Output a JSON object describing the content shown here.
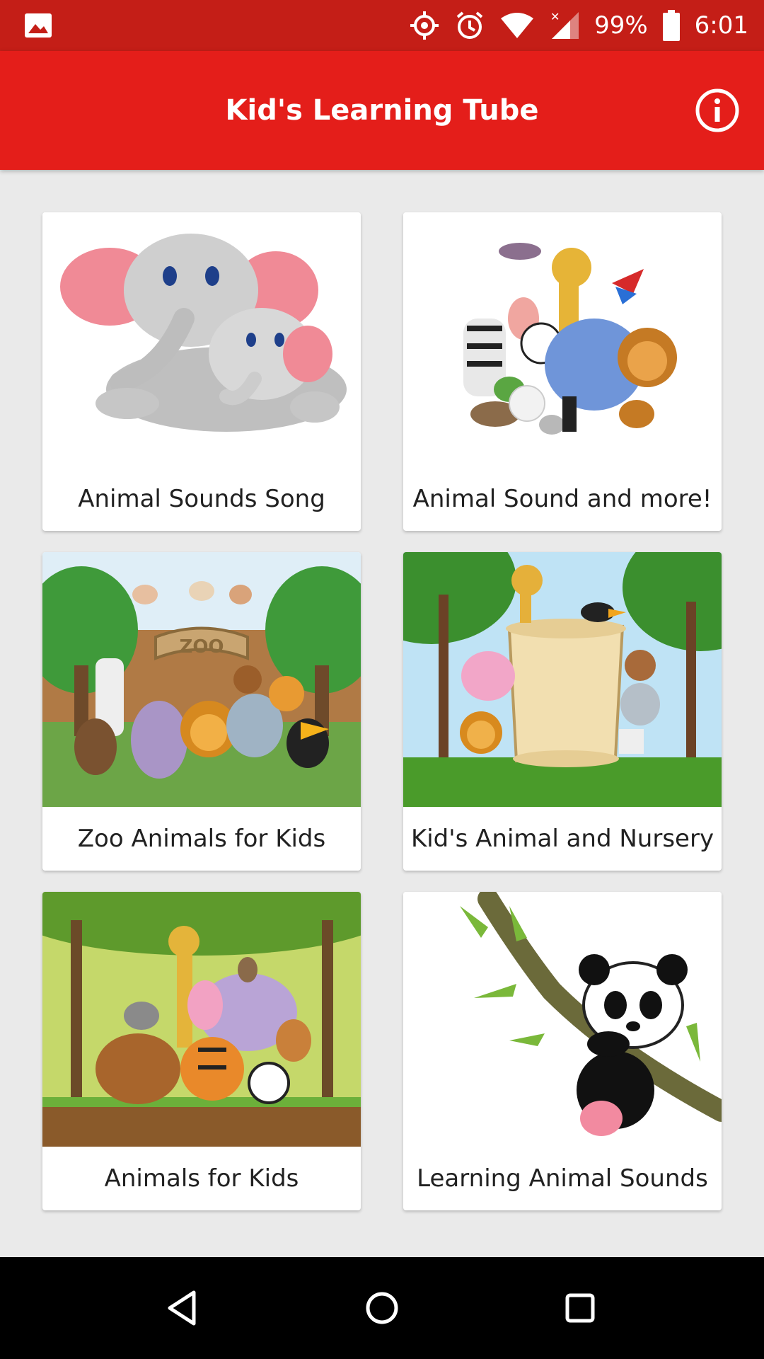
{
  "status_bar": {
    "battery": "99%",
    "time": "6:01",
    "icons": [
      "gallery-icon",
      "location-icon",
      "alarm-icon",
      "wifi-icon",
      "signal-icon",
      "battery-icon"
    ]
  },
  "app_bar": {
    "title": "Kid's Learning Tube",
    "info_icon": "info-icon",
    "color": "#e41e1a"
  },
  "cards": [
    {
      "label": "Animal Sounds Song",
      "image": "elephants-illustration"
    },
    {
      "label": "Animal Sound and more!",
      "image": "animal-group-illustration"
    },
    {
      "label": "Zoo Animals for Kids",
      "image": "zoo-gate-illustration"
    },
    {
      "label": "Kid's Animal and Nursery",
      "image": "jungle-scroll-illustration"
    },
    {
      "label": "Animals for Kids",
      "image": "forest-animals-illustration"
    },
    {
      "label": "Learning Animal Sounds",
      "image": "panda-branch-illustration"
    }
  ],
  "nav_bar": {
    "icons": [
      "back-icon",
      "home-icon",
      "recents-icon"
    ]
  }
}
